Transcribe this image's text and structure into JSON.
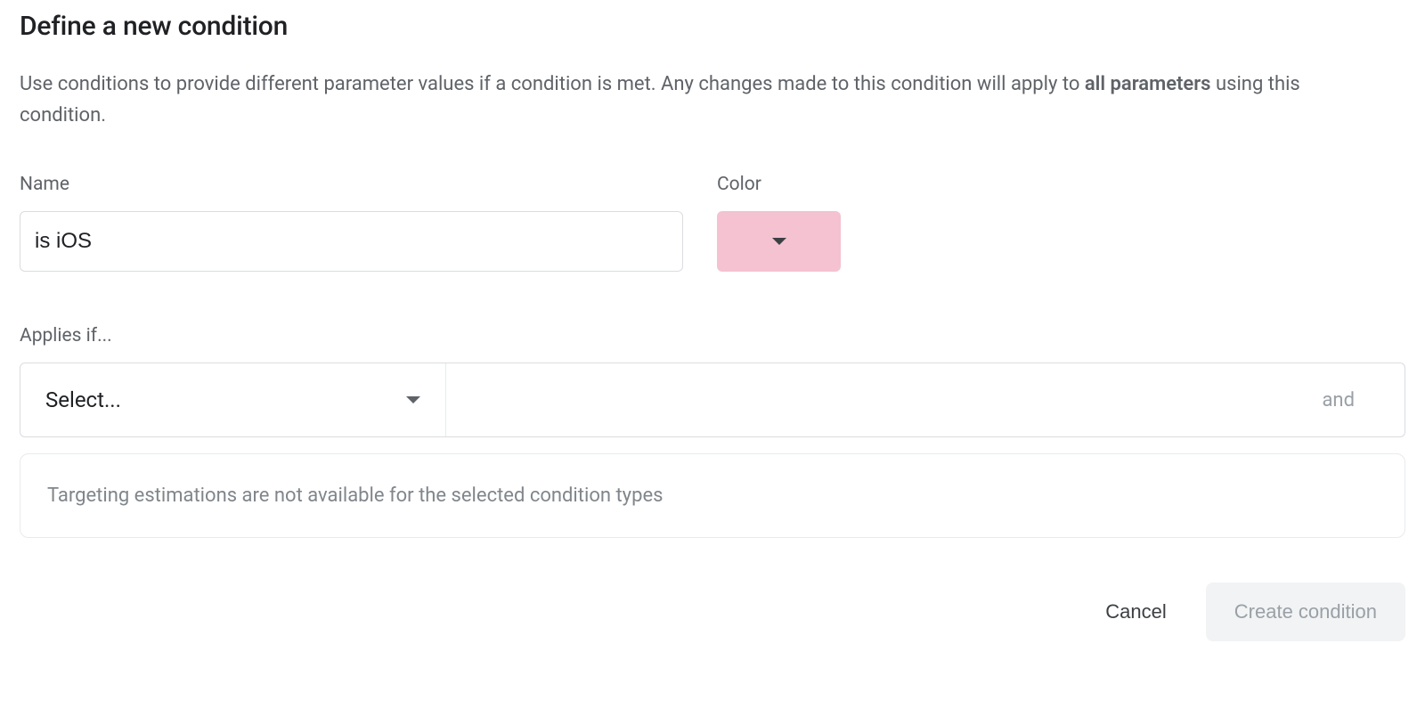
{
  "header": {
    "title": "Define a new condition"
  },
  "description": {
    "pre": "Use conditions to provide different parameter values if a condition is met. Any changes made to this condition will apply to ",
    "bold": "all parameters",
    "post": " using this condition."
  },
  "fields": {
    "name_label": "Name",
    "name_value": "is iOS",
    "color_label": "Color",
    "color_value": "#f4c2d1"
  },
  "applies": {
    "label": "Applies if...",
    "select_placeholder": "Select...",
    "and_label": "and"
  },
  "info": {
    "message": "Targeting estimations are not available for the selected condition types"
  },
  "actions": {
    "cancel": "Cancel",
    "create": "Create condition"
  }
}
